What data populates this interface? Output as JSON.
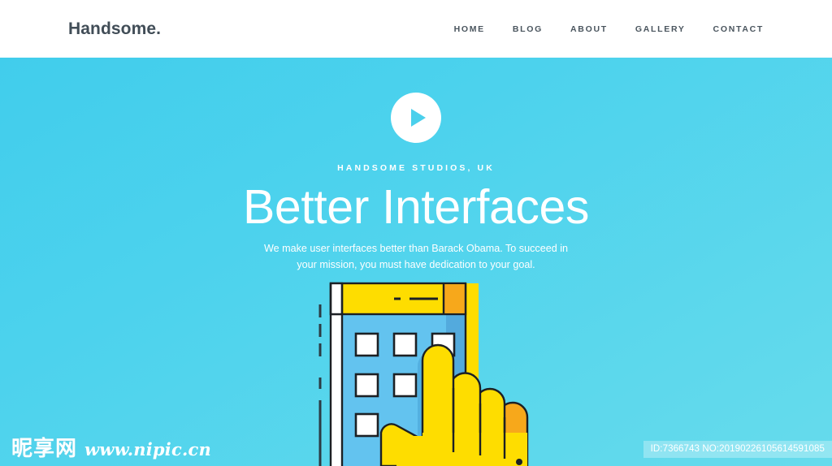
{
  "header": {
    "brand": "Handsome.",
    "nav": [
      {
        "label": "HOME"
      },
      {
        "label": "BLOG"
      },
      {
        "label": "ABOUT"
      },
      {
        "label": "GALLERY"
      },
      {
        "label": "CONTACT"
      }
    ]
  },
  "hero": {
    "play_icon": "play-icon",
    "eyebrow": "HANDSOME STUDIOS, UK",
    "headline": "Better Interfaces",
    "subtext": "We make user interfaces better than Barack Obama. To succeed in your mission, you must have dedication to your goal.",
    "illustration_name": "hand-pointing-at-phone-illustration"
  },
  "colors": {
    "hero_gradient_start": "#41cdec",
    "hero_gradient_end": "#66dbec",
    "header_background": "#ffffff",
    "brand_text": "#414d57",
    "nav_text": "#4a555e",
    "hero_text": "#ffffff",
    "phone_frame_yellow": "#fedd00",
    "phone_accent_orange": "#f7a81b",
    "phone_screen_blue": "#63c3ef",
    "phone_screen_shadow": "#53aadd",
    "app_tile_white": "#ffffff",
    "outline_dark": "#1c2024",
    "hand_yellow": "#fedd00",
    "hand_shadow_orange": "#f7a81b"
  },
  "watermark": {
    "logo_cn": "昵享网",
    "url": "www.nipic.cn",
    "id_badge": "ID:7366743 NO:20190226105614591085"
  }
}
